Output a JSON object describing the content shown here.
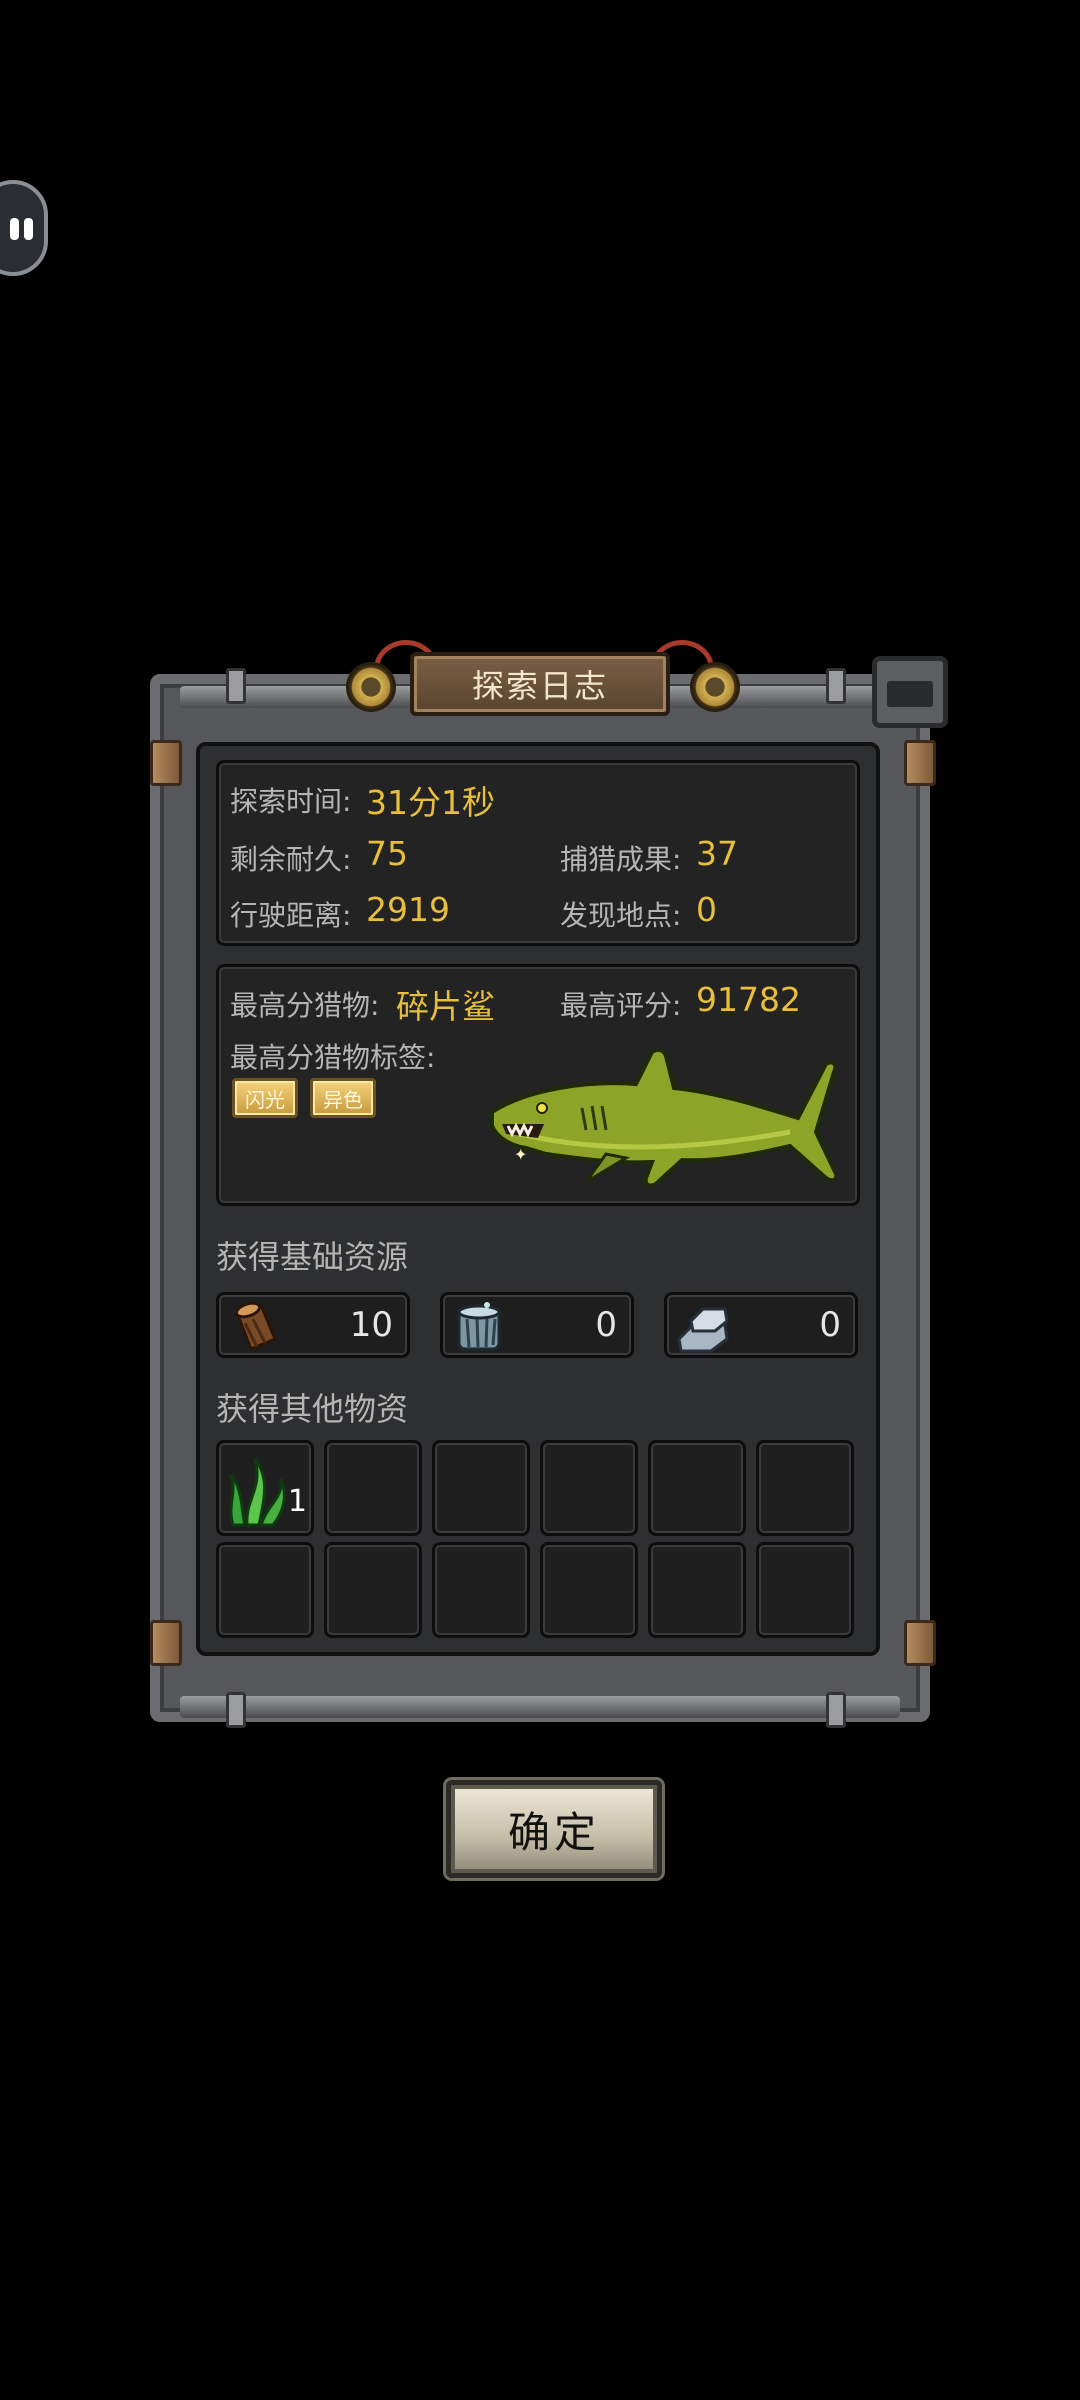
{
  "header": {
    "title": "探索日志"
  },
  "stats": {
    "time_label": "探索时间:",
    "time_value": "31分1秒",
    "durability_label": "剩余耐久:",
    "durability_value": "75",
    "catch_label": "捕猎成果:",
    "catch_value": "37",
    "distance_label": "行驶距离:",
    "distance_value": "2919",
    "discover_label": "发现地点:",
    "discover_value": "0"
  },
  "best_prey": {
    "name_label": "最高分猎物:",
    "name_value": "碎片鲨",
    "score_label": "最高评分:",
    "score_value": "91782",
    "tags_label": "最高分猎物标签:",
    "tags": [
      "闪光",
      "异色"
    ],
    "image": "green-shark"
  },
  "basic_resources": {
    "title": "获得基础资源",
    "items": [
      {
        "icon": "wood-log-icon",
        "value": "10"
      },
      {
        "icon": "barrel-icon",
        "value": "0"
      },
      {
        "icon": "metal-ingot-icon",
        "value": "0"
      }
    ]
  },
  "other_items": {
    "title": "获得其他物资",
    "slots": [
      {
        "icon": "seaweed-icon",
        "count": "1"
      }
    ]
  },
  "confirm_label": "确定",
  "colors": {
    "value_gold": "#e8be3a",
    "label_gray": "#b5b5b5"
  }
}
